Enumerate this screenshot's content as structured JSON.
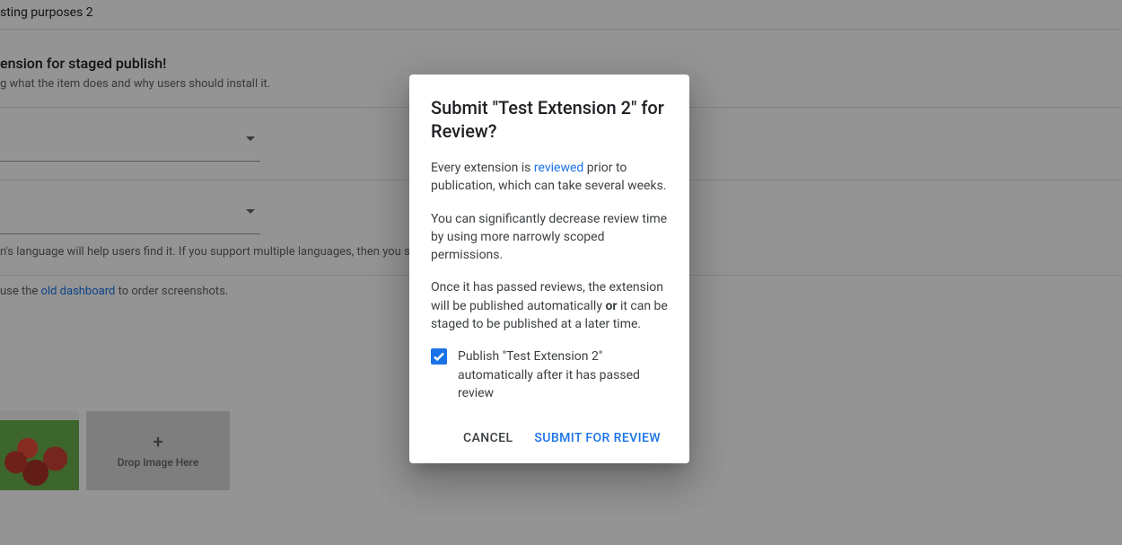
{
  "background": {
    "title_fragment": "sting purposes 2",
    "section_heading": "ension for staged publish!",
    "section_hint": "g what the item does and why users should install it.",
    "language_hint_prefix": "n's language will help users find it. If you support multiple languages, then you sh",
    "screenshots_hint_prefix": "use the ",
    "screenshots_link": "old dashboard",
    "screenshots_hint_suffix": " to order screenshots.",
    "dropzone_label": "Drop Image Here"
  },
  "dialog": {
    "title": "Submit \"Test Extension 2\" for Review?",
    "p1_prefix": "Every extension is ",
    "p1_link": "reviewed",
    "p1_suffix": " prior to publication, which can take several weeks.",
    "p2": "You can significantly decrease review time by using more narrowly scoped permissions.",
    "p3_prefix": "Once it has passed reviews, the extension will be published automatically ",
    "p3_bold": "or",
    "p3_suffix": " it can be staged to be published at a later time.",
    "checkbox_label": "Publish \"Test Extension 2\" automatically after it has passed review",
    "cancel_label": "Cancel",
    "submit_label": "Submit for Review"
  }
}
